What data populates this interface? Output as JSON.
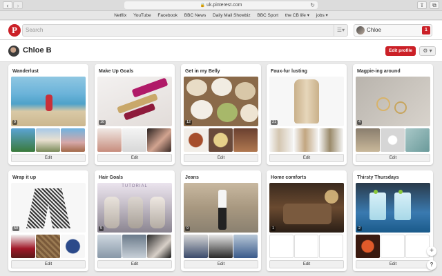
{
  "browser": {
    "back": "‹",
    "forward": "›",
    "url": "uk.pinterest.com",
    "favorites": [
      "Netflix",
      "YouTube",
      "Facebook",
      "BBC News",
      "Daily Mail Showbiz",
      "BBC Sport",
      "the CB life ▾",
      "jobs ▾"
    ]
  },
  "header": {
    "logo": "P",
    "search_placeholder": "Search",
    "user_name": "Chloe",
    "notifications": "1"
  },
  "profile": {
    "name": "Chloe B",
    "edit_label": "Edit profile",
    "settings_icon": "⚙ ▾"
  },
  "boards": [
    {
      "title": "Wanderlust",
      "count": "9",
      "edit": "Edit"
    },
    {
      "title": "Make Up Goals",
      "count": "10",
      "edit": "Edit"
    },
    {
      "title": "Get in my Belly",
      "count": "12",
      "edit": "Edit"
    },
    {
      "title": "Faux-fur lusting",
      "count": "21",
      "edit": "Edit"
    },
    {
      "title": "Magpie-ing around",
      "count": "4",
      "edit": "Edit"
    },
    {
      "title": "Wrap it up",
      "count": "50",
      "edit": "Edit"
    },
    {
      "title": "Hair Goals",
      "count": "5",
      "edit": "Edit"
    },
    {
      "title": "Jeans",
      "count": "9",
      "edit": "Edit"
    },
    {
      "title": "Home comforts",
      "count": "1",
      "edit": "Edit"
    },
    {
      "title": "Thirsty Thursdays",
      "count": "2",
      "edit": "Edit"
    }
  ],
  "hair_cover_text": "TUTORIAL",
  "float": {
    "add": "+",
    "help": "?"
  }
}
